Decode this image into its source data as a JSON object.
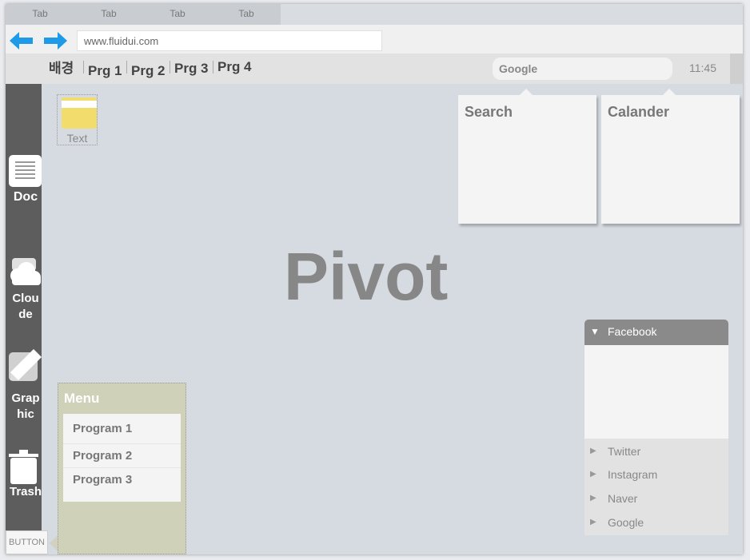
{
  "tabs": [
    "Tab",
    "Tab",
    "Tab",
    "Tab"
  ],
  "address": {
    "url": "www.fluidui.com"
  },
  "programs": [
    "배경",
    "Prg 1",
    "Prg 2",
    "Prg 3",
    "Prg 4"
  ],
  "search_box": {
    "label": "Google"
  },
  "clock": "11:45",
  "dock": {
    "doc": "Doc",
    "cloud": "Clou de",
    "graphic": "Grap hic",
    "trash": "Trash"
  },
  "desktop_icon": {
    "label": "Text"
  },
  "widgets": {
    "search": "Search",
    "calendar": "Calander"
  },
  "center_title": "Pivot",
  "menu": {
    "title": "Menu",
    "items": [
      "Program 1",
      "Program 2",
      "Program 3"
    ]
  },
  "button": {
    "label": "BUTTON"
  },
  "social": {
    "facebook": "Facebook",
    "items": [
      "Twitter",
      "Instagram",
      "Naver",
      "Google"
    ]
  }
}
